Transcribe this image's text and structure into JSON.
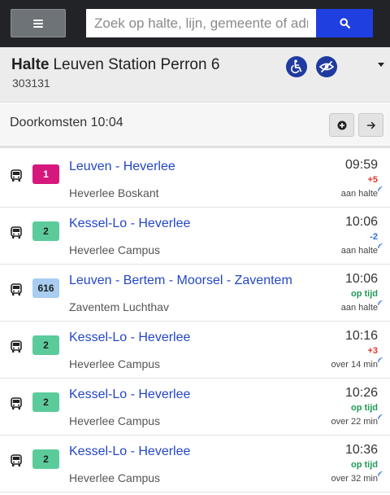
{
  "colors": {
    "accent": "#1f3fe0",
    "header": "#222326",
    "link": "#2346c7",
    "late": "#e0362c",
    "early": "#2a6fdb",
    "ontime": "#1f9a57"
  },
  "search": {
    "placeholder": "Zoek op halte, lijn, gemeente of adres"
  },
  "stop": {
    "label": "Halte",
    "name": "Leuven Station Perron 6",
    "id": "303131",
    "icons": [
      "wheelchair-icon",
      "visually-impaired-icon"
    ]
  },
  "passages": {
    "title": "Doorkomsten 10:04"
  },
  "departures": [
    {
      "line": "1",
      "line_bg": "#d6187c",
      "line_fg": "#ffffff",
      "route": "Leuven - Heverlee",
      "destination": "Heverlee Boskant",
      "time": "09:59",
      "delay": "+5",
      "delay_color": "#e0362c",
      "status": "aan halte"
    },
    {
      "line": "2",
      "line_bg": "#5ccb9b",
      "line_fg": "#1e1e1e",
      "route": "Kessel-Lo - Heverlee",
      "destination": "Heverlee Campus",
      "time": "10:06",
      "delay": "-2",
      "delay_color": "#2a6fdb",
      "status": "aan halte"
    },
    {
      "line": "616",
      "line_bg": "#a9cdf0",
      "line_fg": "#1e1e1e",
      "route": "Leuven - Bertem - Moorsel - Zaventem",
      "destination": "Zaventem Luchthav",
      "time": "10:06",
      "delay": "op tijd",
      "delay_color": "#1f9a57",
      "status": "aan halte"
    },
    {
      "line": "2",
      "line_bg": "#5ccb9b",
      "line_fg": "#1e1e1e",
      "route": "Kessel-Lo - Heverlee",
      "destination": "Heverlee Campus",
      "time": "10:16",
      "delay": "+3",
      "delay_color": "#e0362c",
      "status": "over 14 min"
    },
    {
      "line": "2",
      "line_bg": "#5ccb9b",
      "line_fg": "#1e1e1e",
      "route": "Kessel-Lo - Heverlee",
      "destination": "Heverlee Campus",
      "time": "10:26",
      "delay": "op tijd",
      "delay_color": "#1f9a57",
      "status": "over 22 min"
    },
    {
      "line": "2",
      "line_bg": "#5ccb9b",
      "line_fg": "#1e1e1e",
      "route": "Kessel-Lo - Heverlee",
      "destination": "Heverlee Campus",
      "time": "10:36",
      "delay": "op tijd",
      "delay_color": "#1f9a57",
      "status": "over 32 min"
    }
  ]
}
